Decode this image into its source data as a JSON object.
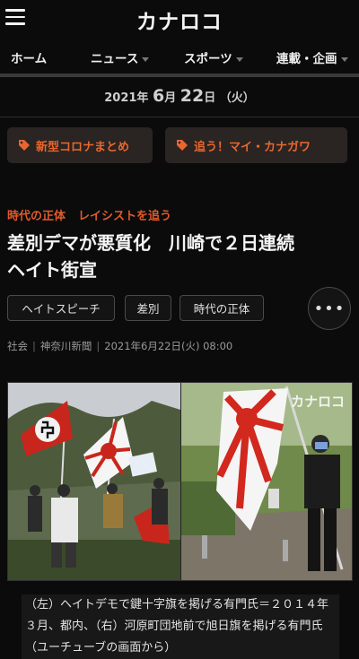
{
  "header": {
    "logo": "カナロコ"
  },
  "nav": {
    "items": [
      {
        "label": "ホーム",
        "dropdown": false
      },
      {
        "label": "ニュース",
        "dropdown": true
      },
      {
        "label": "スポーツ",
        "dropdown": true
      },
      {
        "label": "連載・企画",
        "dropdown": true
      }
    ]
  },
  "date": {
    "year": "2021",
    "year_unit": "年",
    "month": "6",
    "month_unit": "月",
    "day": "22",
    "day_unit": "日",
    "weekday": "（火）"
  },
  "topics": [
    {
      "label": "新型コロナまとめ"
    },
    {
      "label": "追う！マイ・カナガワ"
    }
  ],
  "article": {
    "series": [
      "時代の正体",
      "レイシストを追う"
    ],
    "title_line1": "差別デマが悪質化　川崎で２日連続",
    "title_line2": "ヘイト街宣",
    "tags": [
      "ヘイトスピーチ",
      "差別",
      "時代の正体"
    ],
    "more_label": "•••",
    "meta": {
      "category": "社会",
      "source": "神奈川新聞",
      "datetime": "2021年6月22日(火) 08:00"
    },
    "photo_watermark": "カナロコ",
    "caption": "（左）ヘイトデモで鍵十字旗を掲げる有門氏＝２０１４年３月、都内、（右）河原町団地前で旭日旗を掲げる有門氏（ユーチューブの画面から）"
  },
  "colors": {
    "accent": "#e05a2b",
    "background": "#0b0b0b"
  }
}
